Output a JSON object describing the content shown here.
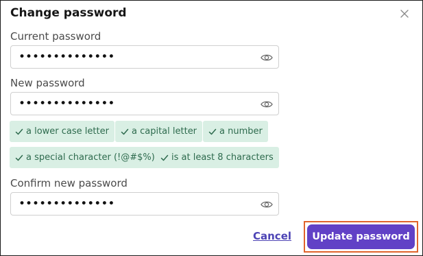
{
  "dialog": {
    "title": "Change password",
    "close_icon": "close-icon"
  },
  "fields": {
    "current": {
      "label": "Current password",
      "value": "••••••••••••••",
      "toggle_icon": "eye-icon"
    },
    "new": {
      "label": "New password",
      "value": "••••••••••••••",
      "toggle_icon": "eye-icon"
    },
    "confirm": {
      "label": "Confirm new password",
      "value": "••••••••••••••",
      "toggle_icon": "eye-icon"
    }
  },
  "requirements": [
    {
      "label": "a lower case letter",
      "met": true
    },
    {
      "label": "a capital letter",
      "met": true
    },
    {
      "label": "a number",
      "met": true
    },
    {
      "label": "a special character (!@#$%)",
      "met": true
    },
    {
      "label": "is at least 8 characters",
      "met": true
    }
  ],
  "actions": {
    "cancel_label": "Cancel",
    "update_label": "Update password"
  },
  "colors": {
    "primary": "#6141c6",
    "link": "#4d44b5",
    "chip_bg": "#d9efe4",
    "chip_text": "#2e6b4e",
    "focus_outline": "#e0632b"
  }
}
